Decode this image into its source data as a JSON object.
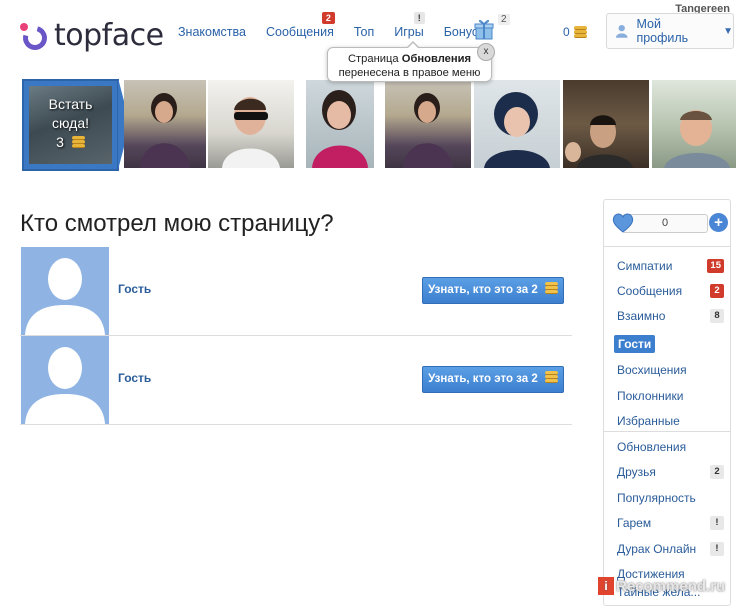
{
  "header": {
    "username": "Tangereen",
    "logo_text": "topface",
    "nav": [
      {
        "label": "Знакомства",
        "badge": ""
      },
      {
        "label": "Сообщения",
        "badge": "2"
      },
      {
        "label": "Топ",
        "badge": ""
      },
      {
        "label": "Игры",
        "badge": "!"
      },
      {
        "label": "Бонусы",
        "badge": ""
      }
    ],
    "gift_count": "2",
    "coins": "0",
    "profile_label": "Мой профиль"
  },
  "tooltip": {
    "line1_prefix": "Страница ",
    "line1_bold": "Обновления",
    "line2": "перенесена в правое меню",
    "close": "x"
  },
  "promo": {
    "line1": "Встать",
    "line2": "сюда!",
    "price": "3"
  },
  "main": {
    "title": "Кто смотрел мою страницу?",
    "guests": [
      {
        "name": "Гость",
        "button": "Узнать, кто это за 2"
      },
      {
        "name": "Гость",
        "button": "Узнать, кто это за 2"
      }
    ]
  },
  "sidebar": {
    "likes": "0",
    "plus": "+",
    "items": [
      {
        "label": "Симпатии",
        "count": "15",
        "count_style": "red"
      },
      {
        "label": "Сообщения",
        "count": "2",
        "count_style": "red"
      },
      {
        "label": "Взаимно",
        "count": "8",
        "count_style": "grey"
      },
      {
        "label": "Гости",
        "count": "",
        "count_style": "active"
      },
      {
        "label": "Восхищения",
        "count": "",
        "count_style": ""
      },
      {
        "label": "Поклонники",
        "count": "",
        "count_style": ""
      },
      {
        "label": "Избранные",
        "count": "",
        "count_style": ""
      },
      {
        "label": "Обновления",
        "count": "",
        "count_style": ""
      },
      {
        "label": "Друзья",
        "count": "2",
        "count_style": "grey"
      },
      {
        "label": "Популярность",
        "count": "",
        "count_style": ""
      },
      {
        "label": "Гарем",
        "count": "!",
        "count_style": "grey"
      },
      {
        "label": "Дурак Онлайн",
        "count": "!",
        "count_style": "grey"
      },
      {
        "label": "Достижения",
        "count": "",
        "count_style": ""
      },
      {
        "label": "Тайные жела...",
        "count": "",
        "count_style": ""
      }
    ]
  },
  "watermark": {
    "ir": "i",
    "text": "Recommend.ru"
  },
  "colors": {
    "link": "#2a62a8",
    "accent": "#3c7fcf",
    "badge_red": "#d13b2b"
  }
}
